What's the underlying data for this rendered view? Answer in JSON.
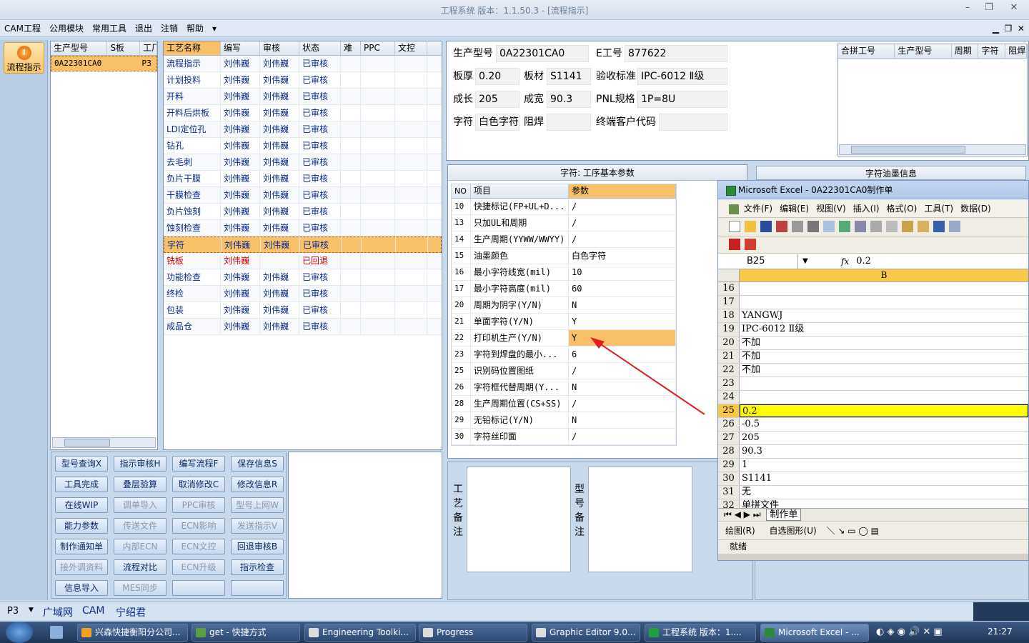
{
  "window": {
    "title": "工程系统   版本：1.1.50.3 - [流程指示]"
  },
  "menu": [
    "CAM工程",
    "公用模块",
    "常用工具",
    "退出",
    "注销",
    "帮助"
  ],
  "leftbar": {
    "button": "流程指示"
  },
  "model_list": {
    "headers": [
      "生产型号",
      "S板",
      "工厂"
    ],
    "rows": [
      [
        "0A22301CA0",
        "",
        "P3"
      ]
    ]
  },
  "process": {
    "headers": [
      "工艺名称",
      "编写",
      "审核",
      "状态",
      "难",
      "PPC",
      "文控"
    ],
    "rows": [
      [
        "流程指示",
        "刘伟巍",
        "刘伟巍",
        "已审核"
      ],
      [
        "计划投料",
        "刘伟巍",
        "刘伟巍",
        "已审核"
      ],
      [
        "开料",
        "刘伟巍",
        "刘伟巍",
        "已审核"
      ],
      [
        "开料后烘板",
        "刘伟巍",
        "刘伟巍",
        "已审核"
      ],
      [
        "LDI定位孔",
        "刘伟巍",
        "刘伟巍",
        "已审核"
      ],
      [
        "钻孔",
        "刘伟巍",
        "刘伟巍",
        "已审核"
      ],
      [
        "去毛刺",
        "刘伟巍",
        "刘伟巍",
        "已审核"
      ],
      [
        "负片干膜",
        "刘伟巍",
        "刘伟巍",
        "已审核"
      ],
      [
        "干膜检查",
        "刘伟巍",
        "刘伟巍",
        "已审核"
      ],
      [
        "负片蚀刻",
        "刘伟巍",
        "刘伟巍",
        "已审核"
      ],
      [
        "蚀刻检查",
        "刘伟巍",
        "刘伟巍",
        "已审核"
      ],
      [
        "字符",
        "刘伟巍",
        "刘伟巍",
        "已审核"
      ],
      [
        "铣板",
        "刘伟巍",
        "",
        "已回退"
      ],
      [
        "功能检查",
        "刘伟巍",
        "刘伟巍",
        "已审核"
      ],
      [
        "终检",
        "刘伟巍",
        "刘伟巍",
        "已审核"
      ],
      [
        "包装",
        "刘伟巍",
        "刘伟巍",
        "已审核"
      ],
      [
        "成品仓",
        "刘伟巍",
        "刘伟巍",
        "已审核"
      ]
    ]
  },
  "buttons": [
    [
      "型号查询X",
      "指示审核H",
      "编写流程F",
      "保存信息S"
    ],
    [
      "工具完成",
      "叠层验算",
      "取消修改C",
      "修改信息R"
    ],
    [
      "在线WIP",
      "调单导入",
      "PPC审核",
      "型号上网W"
    ],
    [
      "能力参数",
      "传送文件",
      "ECN影响",
      "发送指示V"
    ],
    [
      "制作通知单",
      "内部ECN",
      "ECN文控",
      "回退审核B"
    ],
    [
      "接外调资料",
      "流程对比",
      "ECN升级",
      "指示检查"
    ],
    [
      "信息导入",
      "MES同步",
      "",
      ""
    ]
  ],
  "info": {
    "model_label": "生产型号",
    "model": "0A22301CA0",
    "eno_label": "E工号",
    "eno": "877622",
    "thick_label": "板厚",
    "thick": "0.20",
    "mat_label": "板材",
    "mat": "S1141",
    "std_label": "验收标准",
    "std": "IPC-6012 Ⅱ级",
    "len_label": "成长",
    "len": "205",
    "wid_label": "成宽",
    "wid": "90.3",
    "pnl_label": "PNL规格",
    "pnl": "1P=8U",
    "char_label": "字符",
    "char": "白色字符",
    "mask_label": "阻焊",
    "mask": "",
    "cust_label": "终端客户代码",
    "cust": ""
  },
  "combine": {
    "headers": [
      "合拼工号",
      "生产型号",
      "周期",
      "字符",
      "阻焊"
    ]
  },
  "params": {
    "title": "字符: 工序基本参数",
    "headers": [
      "NO",
      "项目",
      "参数"
    ],
    "rows": [
      [
        "10",
        "快捷标记(FP+UL+D...",
        "/"
      ],
      [
        "13",
        "只加UL和周期",
        "/"
      ],
      [
        "14",
        "生产周期(YYWW/WWYY)",
        "/"
      ],
      [
        "15",
        "油墨颜色",
        "白色字符"
      ],
      [
        "16",
        "最小字符线宽(mil)",
        "10"
      ],
      [
        "17",
        "最小字符高度(mil)",
        "60"
      ],
      [
        "20",
        "周期为阴字(Y/N)",
        "N"
      ],
      [
        "21",
        "单面字符(Y/N)",
        "Y"
      ],
      [
        "22",
        "打印机生产(Y/N)",
        "Y"
      ],
      [
        "23",
        "字符到焊盘的最小...",
        "6"
      ],
      [
        "25",
        "识别码位置图纸",
        "/"
      ],
      [
        "26",
        "字符框代替周期(Y...",
        "N"
      ],
      [
        "28",
        "生产周期位置(CS+SS)",
        "/"
      ],
      [
        "29",
        "无铅标记(Y/N)",
        "N"
      ],
      [
        "30",
        "字符丝印面",
        "/"
      ]
    ]
  },
  "oil_title": "字符油墨信息",
  "notes": {
    "process": "工艺备注",
    "model": "型号备注"
  },
  "excel": {
    "title": "Microsoft Excel - 0A22301CA0制作单",
    "menu": [
      "文件(F)",
      "编辑(E)",
      "视图(V)",
      "插入(I)",
      "格式(O)",
      "工具(T)",
      "数据(D)"
    ],
    "namebox": "B25",
    "fx": "0.2",
    "col": "B",
    "rows": [
      [
        "16",
        ""
      ],
      [
        "17",
        ""
      ],
      [
        "18",
        "YANGWJ"
      ],
      [
        "19",
        "IPC-6012 Ⅱ级"
      ],
      [
        "20",
        "不加"
      ],
      [
        "21",
        "不加"
      ],
      [
        "22",
        "不加"
      ],
      [
        "23",
        ""
      ],
      [
        "24",
        ""
      ],
      [
        "25",
        "0.2"
      ],
      [
        "26",
        "-0.5"
      ],
      [
        "27",
        "205"
      ],
      [
        "28",
        "90.3"
      ],
      [
        "29",
        "1"
      ],
      [
        "30",
        "S1141"
      ],
      [
        "31",
        "无"
      ],
      [
        "32",
        "单拼文件"
      ]
    ],
    "sheet": "制作单",
    "draw": "绘图(R)",
    "autoshape": "自选图形(U)",
    "status": "就绪"
  },
  "statusbar": {
    "factory": "P3",
    "items": [
      "广域网",
      "CAM",
      "宁绍君"
    ]
  },
  "taskbar": {
    "items": [
      "兴森快捷衡阳分公司...",
      "get - 快捷方式",
      "Engineering Toolki...",
      "Progress",
      "Graphic Editor 9.0...",
      "工程系统  版本：1....",
      "Microsoft Excel - ..."
    ],
    "clock": "21:27"
  }
}
